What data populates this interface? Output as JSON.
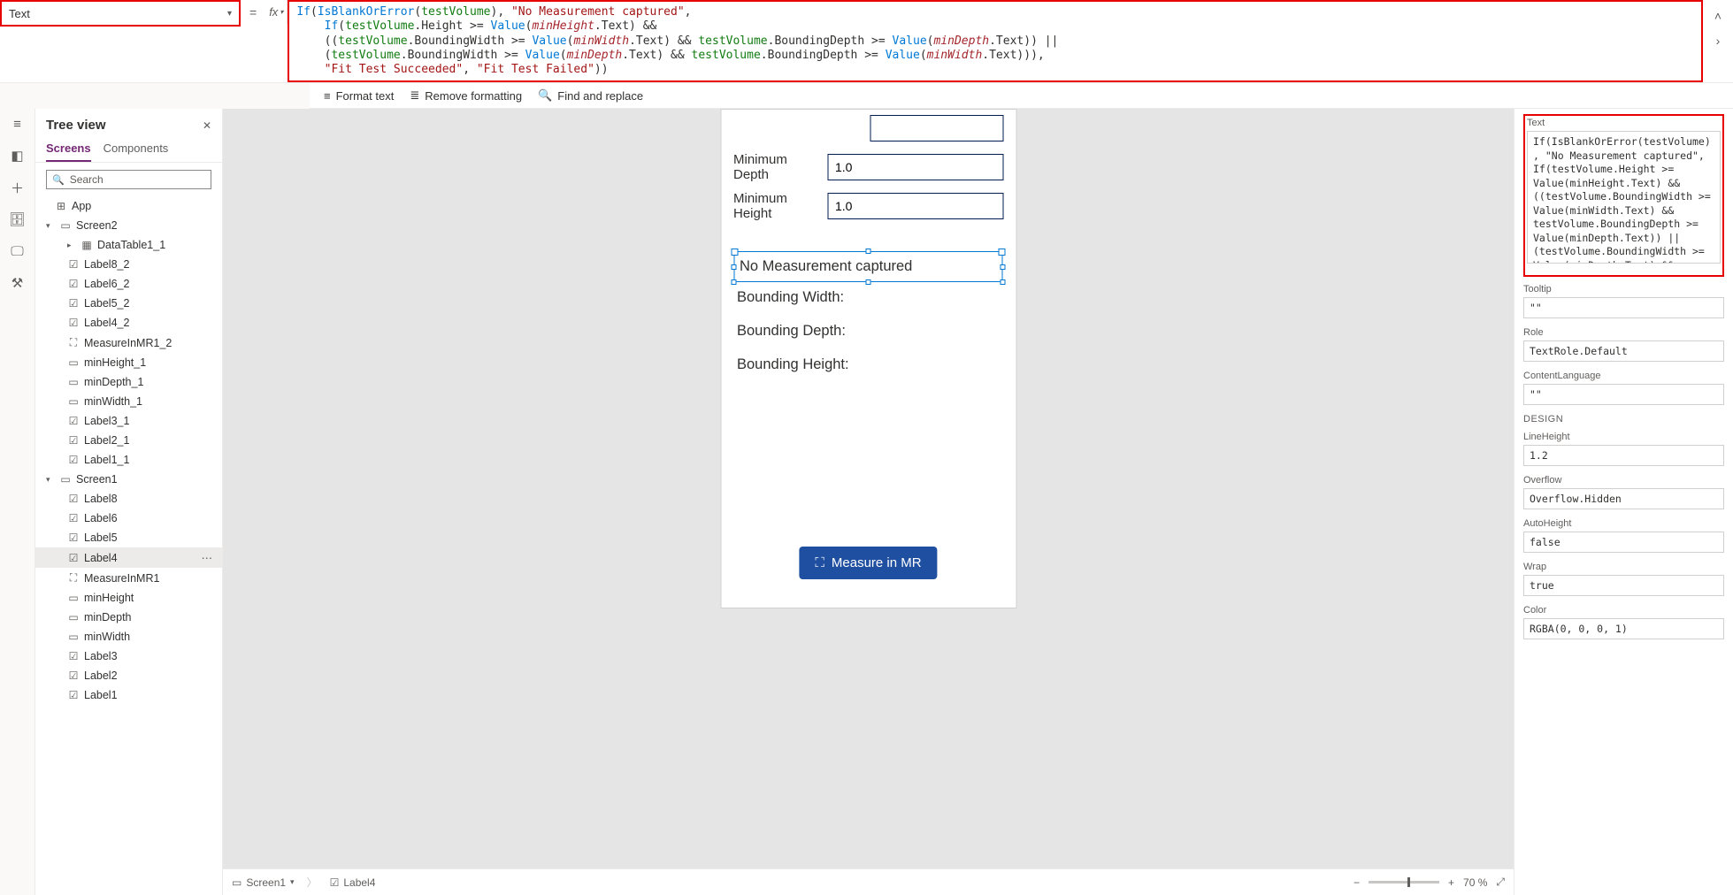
{
  "propSelector": "Text",
  "formulaPlain": "If(IsBlankOrError(testVolume), \"No Measurement captured\",\n    If(testVolume.Height >= Value(minHeight.Text) &&\n    ((testVolume.BoundingWidth >= Value(minWidth.Text) && testVolume.BoundingDepth >= Value(minDepth.Text)) ||\n    (testVolume.BoundingWidth >= Value(minDepth.Text) && testVolume.BoundingDepth >= Value(minWidth.Text))),\n    \"Fit Test Succeeded\", \"Fit Test Failed\"))",
  "fmtBar": {
    "format": "Format text",
    "remove": "Remove formatting",
    "find": "Find and replace"
  },
  "tree": {
    "title": "Tree view",
    "tabs": {
      "screens": "Screens",
      "components": "Components"
    },
    "search": "Search",
    "app": "App",
    "screen2": "Screen2",
    "s2": {
      "datatable": "DataTable1_1",
      "l8": "Label8_2",
      "l6": "Label6_2",
      "l5": "Label5_2",
      "l4": "Label4_2",
      "measure": "MeasureInMR1_2",
      "minH": "minHeight_1",
      "minD": "minDepth_1",
      "minW": "minWidth_1",
      "l3": "Label3_1",
      "l2": "Label2_1",
      "l1": "Label1_1"
    },
    "screen1": "Screen1",
    "s1": {
      "l8": "Label8",
      "l6": "Label6",
      "l5": "Label5",
      "l4": "Label4",
      "measure": "MeasureInMR1",
      "minH": "minHeight",
      "minD": "minDepth",
      "minW": "minWidth",
      "l3": "Label3",
      "l2": "Label2",
      "l1": "Label1"
    }
  },
  "canvas": {
    "minDepthLabel": "Minimum Depth",
    "minDepthVal": "1.0",
    "minHeightLabel": "Minimum Height",
    "minHeightVal": "1.0",
    "selLabel": "No Measurement captured",
    "bw": "Bounding Width:",
    "bd": "Bounding Depth:",
    "bh": "Bounding Height:",
    "mrBtn": "Measure in MR"
  },
  "status": {
    "crumb1": "Screen1",
    "crumb2": "Label4",
    "zoom": "70 %"
  },
  "props": {
    "textLabel": "Text",
    "textVal": "If(IsBlankOrError(testVolume), \"No Measurement captured\",\nIf(testVolume.Height >= Value(minHeight.Text) && ((testVolume.BoundingWidth >= Value(minWidth.Text) && testVolume.BoundingDepth >= Value(minDepth.Text)) || (testVolume.BoundingWidth >= Value(minDepth.Text) &&",
    "tooltipLabel": "Tooltip",
    "tooltipVal": "\"\"",
    "roleLabel": "Role",
    "roleVal": "TextRole.Default",
    "clLabel": "ContentLanguage",
    "clVal": "\"\"",
    "design": "DESIGN",
    "lhLabel": "LineHeight",
    "lhVal": "1.2",
    "ovLabel": "Overflow",
    "ovVal": "Overflow.Hidden",
    "ahLabel": "AutoHeight",
    "ahVal": "false",
    "wrapLabel": "Wrap",
    "wrapVal": "true",
    "colorLabel": "Color",
    "colorVal": "RGBA(0, 0, 0, 1)"
  }
}
